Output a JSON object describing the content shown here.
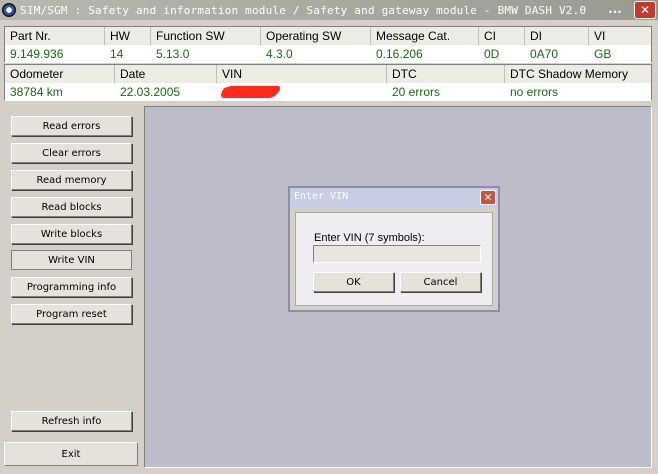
{
  "window": {
    "title": "SIM/SGM : Safety and information module / Safety and gateway module - BMW DASH  V2.0",
    "minimize_label": "...",
    "close_label": "✕"
  },
  "module_info": {
    "headers": [
      "Part Nr.",
      "HW",
      "Function SW",
      "Operating SW",
      "Message Cat.",
      "CI",
      "DI",
      "VI"
    ],
    "values": [
      "9.149.936",
      "14",
      "5.13.0",
      "4.3.0",
      "0.16.206",
      "0D",
      "0A70",
      "GB"
    ]
  },
  "vehicle_info": {
    "headers": [
      "Odometer",
      "Date",
      "VIN",
      "DTC",
      "DTC Shadow Memory"
    ],
    "values": [
      "38784 km",
      "22.03.2005",
      "",
      "20 errors",
      "no errors"
    ]
  },
  "actions": {
    "read_errors": "Read errors",
    "clear_errors": "Clear errors",
    "read_memory": "Read memory",
    "read_blocks": "Read blocks",
    "write_blocks": "Write blocks",
    "write_vin": "Write VIN",
    "programming_info": "Programming info",
    "program_reset": "Program reset",
    "refresh_info": "Refresh info",
    "exit": "Exit"
  },
  "dialog": {
    "title": "Enter VIN",
    "prompt": "Enter VIN (7 symbols):",
    "input_value": "",
    "ok_label": "OK",
    "cancel_label": "Cancel",
    "close_label": "✕"
  },
  "colors": {
    "value_text": "#1a6b10",
    "vin_redaction": "#ff2a1a",
    "workspace": "#bdbdca"
  }
}
